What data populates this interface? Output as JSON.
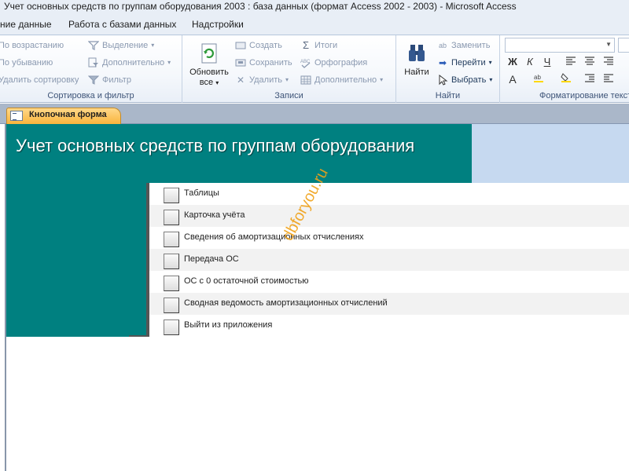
{
  "window": {
    "title": "Учет основных средств по группам оборудования 2003 : база данных (формат Access 2002 - 2003)  -  Microsoft Access"
  },
  "ribbon_tabs": [
    {
      "label": "ние данные"
    },
    {
      "label": "Работа с базами данных"
    },
    {
      "label": "Надстройки"
    }
  ],
  "ribbon": {
    "sort_filter": {
      "ascending": "По возрастанию",
      "descending": "По убыванию",
      "clear_sort": "Удалить сортировку",
      "selection": "Выделение",
      "advanced": "Дополнительно",
      "filter": "Фильтр",
      "group_label": "Сортировка и фильтр"
    },
    "records": {
      "refresh_line1": "Обновить",
      "refresh_line2": "все",
      "new": "Создать",
      "save": "Сохранить",
      "delete": "Удалить",
      "totals": "Итоги",
      "spelling": "Орфография",
      "more": "Дополнительно",
      "group_label": "Записи"
    },
    "find": {
      "find": "Найти",
      "replace": "Заменить",
      "goto": "Перейти",
      "select": "Выбрать",
      "group_label": "Найти"
    },
    "formatting": {
      "bold": "Ж",
      "italic": "К",
      "underline": "Ч",
      "font_color": "A",
      "group_label": "Форматирование текста"
    }
  },
  "document_tab": {
    "label": "Кнопочная форма"
  },
  "form": {
    "title": "Учет основных средств по группам оборудования",
    "items": [
      {
        "label": "Таблицы"
      },
      {
        "label": "Карточка учёта"
      },
      {
        "label": "Сведения об амортизационных отчислениях"
      },
      {
        "label": "Передача ОС"
      },
      {
        "label": "ОС с 0 остаточной стоимостью"
      },
      {
        "label": "Сводная ведомость амортизационных отчислений"
      },
      {
        "label": "Выйти из приложения"
      }
    ]
  },
  "watermark": "dbforyou.ru",
  "colors": {
    "header_bg": "#008080",
    "header_right_bg": "#c6d9f0",
    "doc_tab_bg": "#f9b43c",
    "alt_row_bg": "#f2f2f2"
  }
}
